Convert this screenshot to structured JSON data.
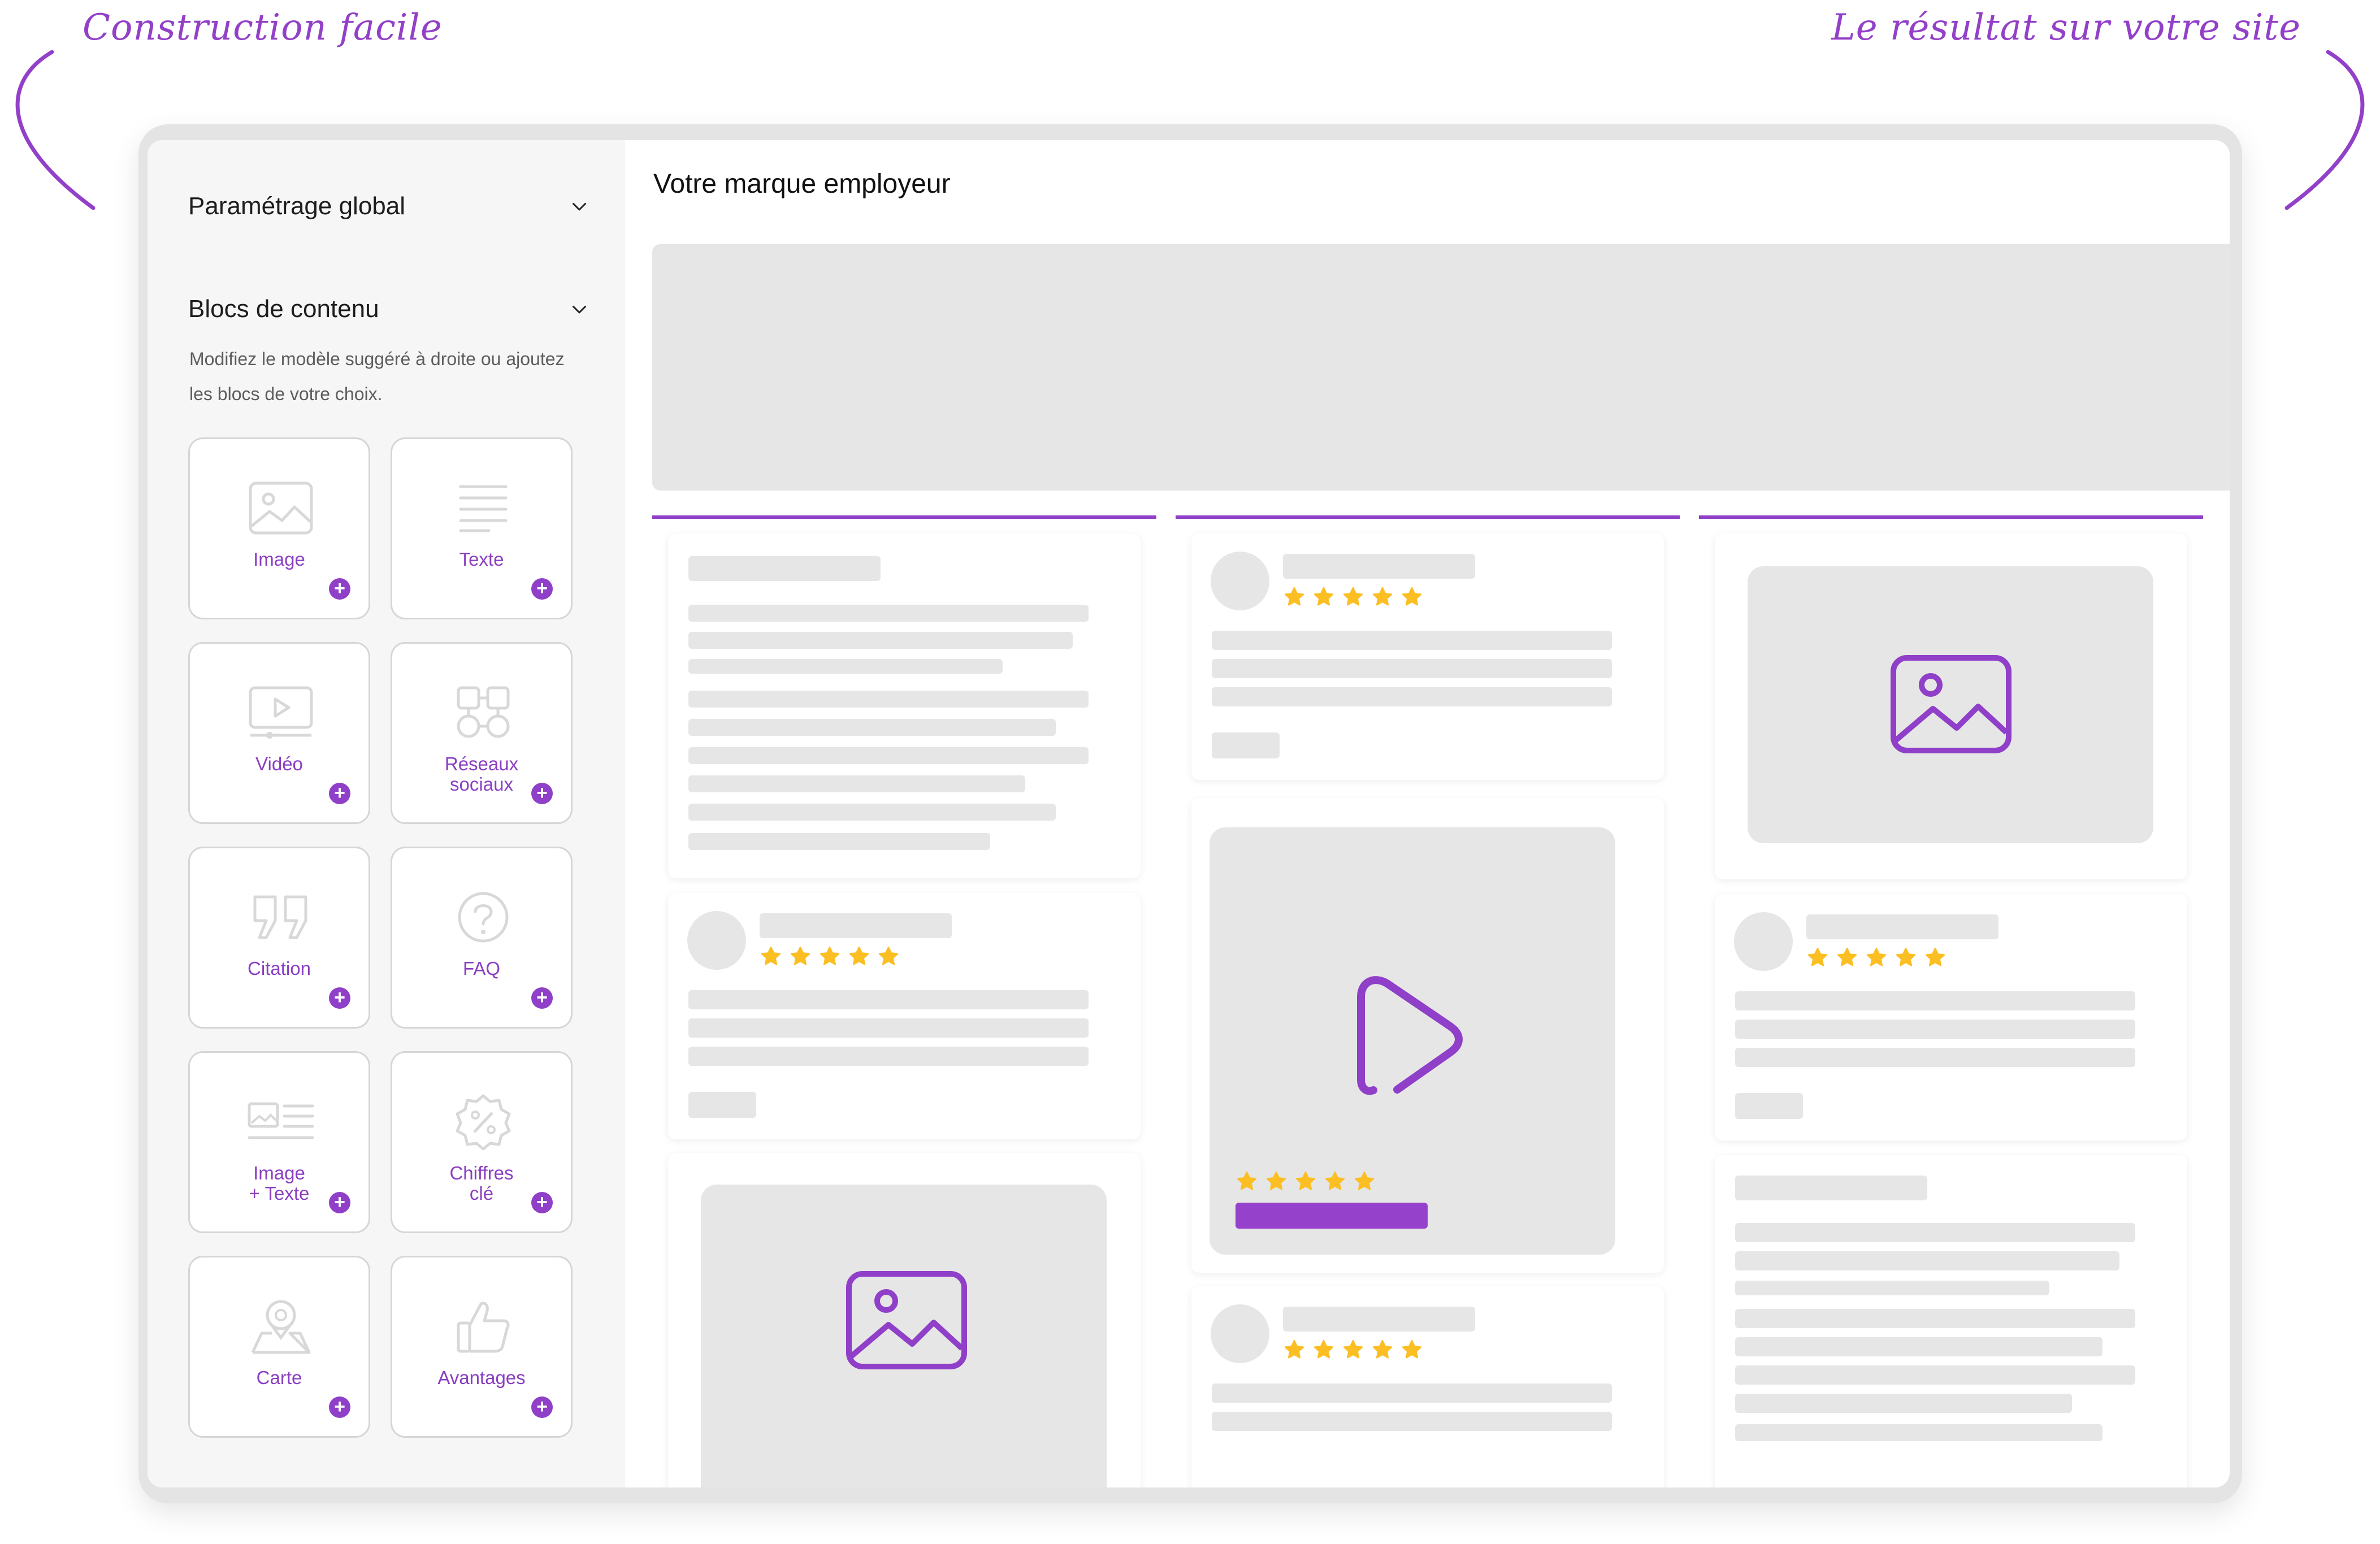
{
  "annotations": {
    "left": "Construction facile",
    "right": "Le résultat sur votre site"
  },
  "colors": {
    "accent": "#8f3fc8",
    "star": "#fbbf24",
    "placeholder": "#e6e6e6"
  },
  "sidebar": {
    "sections": [
      {
        "label": "Paramétrage global"
      },
      {
        "label": "Blocs de contenu",
        "description": "Modifiez le modèle suggéré à droite ou ajoutez les blocs de votre choix."
      }
    ],
    "blocks": [
      {
        "label": "Image",
        "icon": "image-icon"
      },
      {
        "label": "Texte",
        "icon": "text-icon"
      },
      {
        "label": "Vidéo",
        "icon": "video-icon"
      },
      {
        "label": "Réseaux\nsociaux",
        "icon": "social-icon"
      },
      {
        "label": "Citation",
        "icon": "quote-icon"
      },
      {
        "label": "FAQ",
        "icon": "faq-icon"
      },
      {
        "label": "Image\n+ Texte",
        "icon": "image-text-icon"
      },
      {
        "label": "Chiffres\nclé",
        "icon": "percent-icon"
      },
      {
        "label": "Carte",
        "icon": "map-pin-icon"
      },
      {
        "label": "Avantages",
        "icon": "thumbs-up-icon"
      }
    ]
  },
  "preview": {
    "title": "Votre marque employeur",
    "rating_stars": 5
  }
}
